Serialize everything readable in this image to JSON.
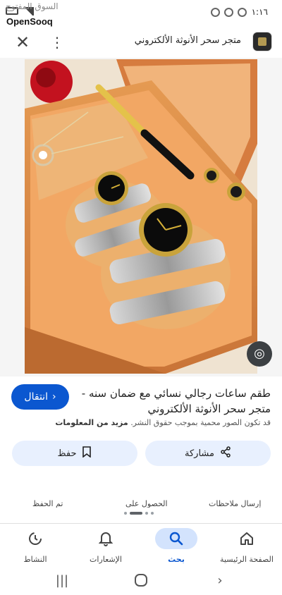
{
  "status_bar": {
    "time": "١:١٦"
  },
  "watermark": {
    "arabic": "السوق المفتوح",
    "brand": "OpenSooq"
  },
  "top_bar": {
    "site_title": "متجر سحر الأنوثة الألكتروني"
  },
  "result": {
    "title": "طقم ساعات رجالي نسائي مع ضمان سنه - متجر سحر الأنوثة الألكتروني",
    "copyright_text": "قد تكون الصور محمية بموجب حقوق النشر.",
    "learn_more": "مزيد من المعلومات",
    "visit_label": "انتقال"
  },
  "actions": {
    "save_label": "حفظ",
    "share_label": "مشاركة"
  },
  "partial_actions": [
    "تم الحفظ",
    "الحصول على",
    "إرسال ملاحظات"
  ],
  "bottom_nav": {
    "items": [
      {
        "label": "النشاط",
        "icon": "activity-icon",
        "active": false
      },
      {
        "label": "الإشعارات",
        "icon": "bell-icon",
        "active": false
      },
      {
        "label": "بحث",
        "icon": "search-icon",
        "active": true
      },
      {
        "label": "الصفحة الرئيسية",
        "icon": "home-icon",
        "active": false
      }
    ]
  },
  "colors": {
    "accent": "#0b57d0",
    "pill_bg": "#e8f0fe",
    "active_nav_bg": "#d3e3fd"
  }
}
